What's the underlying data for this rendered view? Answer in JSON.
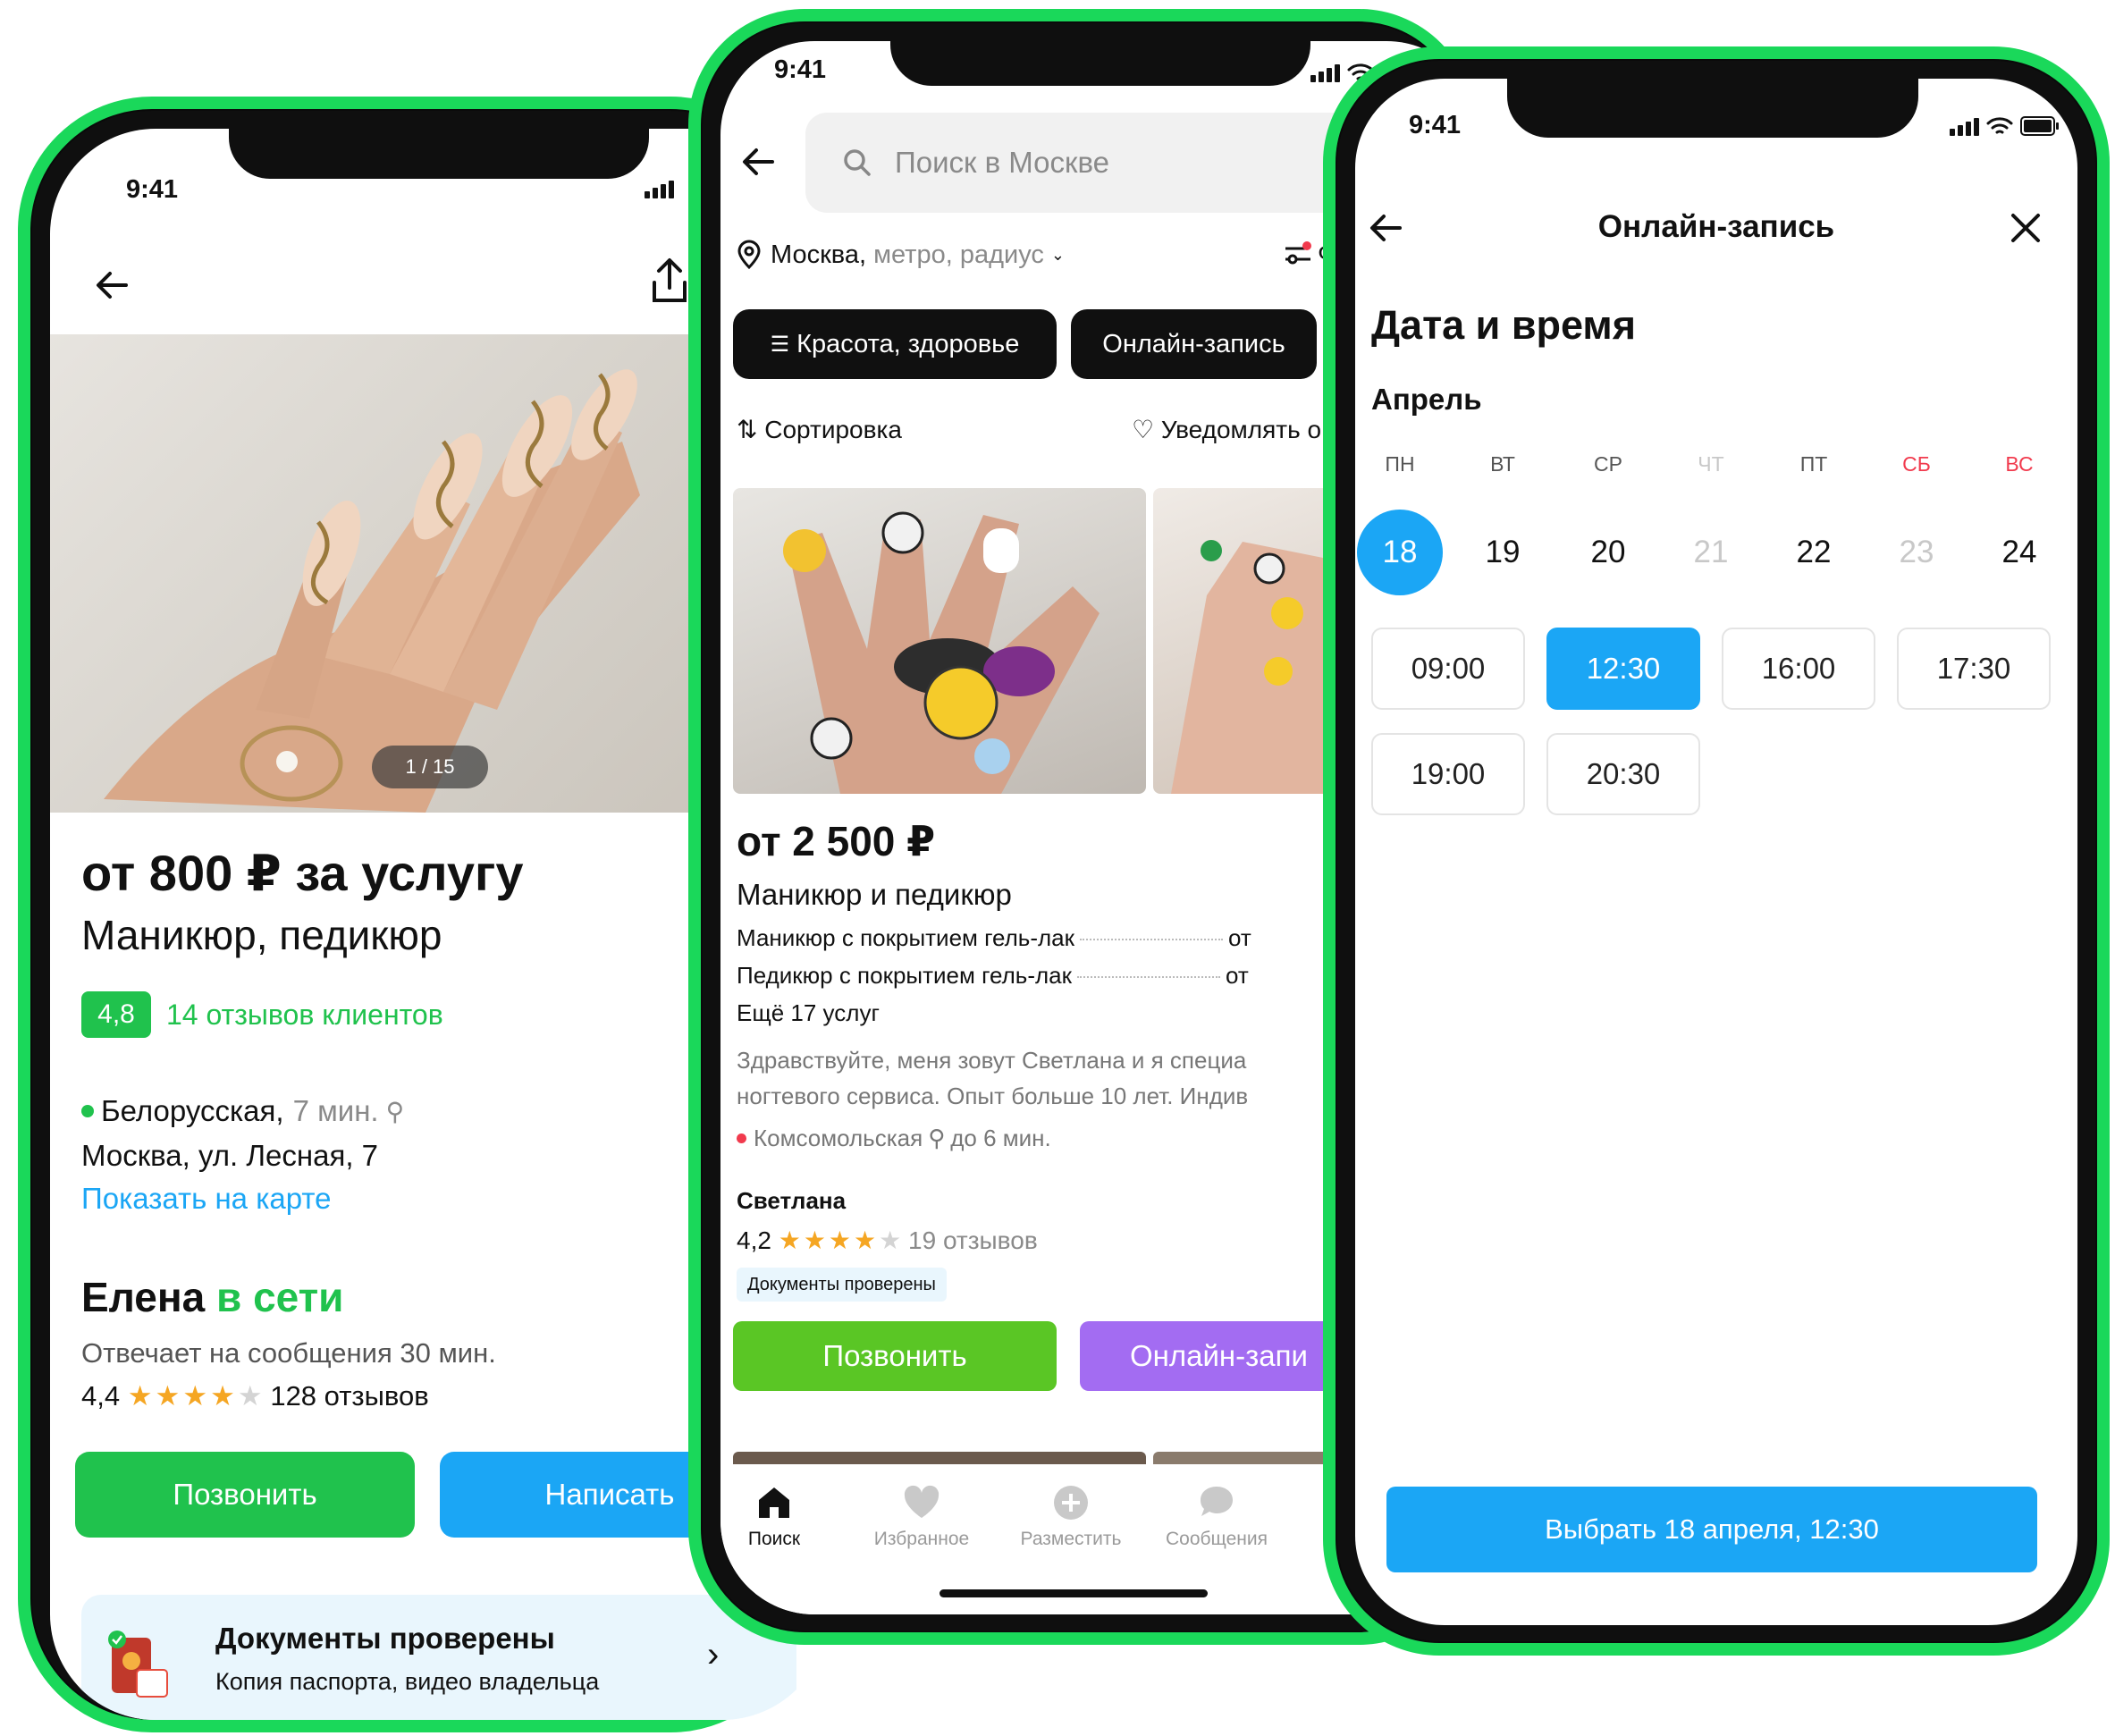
{
  "colors": {
    "brand_green": "#1ad85a",
    "green": "#20c24d",
    "blue": "#1ba6f5",
    "purple": "#a36cf2",
    "red": "#f13a4d"
  },
  "status": {
    "time": "9:41"
  },
  "phone1": {
    "photo_counter": "1 / 15",
    "price": "от 800 ₽ за услугу",
    "category": "Маникюр, педикюр",
    "rating": "4,8",
    "reviews": "14 отзывов клиентов",
    "metro": "Белорусская,",
    "metro_time": "7 мин.",
    "address": "Москва, ул. Лесная, 7",
    "map_link": "Показать на карте",
    "seller_name": "Елена",
    "seller_status": "в сети",
    "response": "Отвечает на сообщения 30 мин.",
    "seller_rating": "4,4",
    "seller_stars": "★★★★",
    "seller_star_empty": "★",
    "seller_reviews": "128 отзывов",
    "call": "Позвонить",
    "write": "Написать",
    "docs_title": "Документы проверены",
    "docs_sub": "Копия паспорта, видео владельца",
    "docs_arrow": "›"
  },
  "phone2": {
    "search_placeholder": "Поиск в Москве",
    "location": "Москва,",
    "location_extra": "метро, радиус",
    "filters": "Фи",
    "chip1": "Красота, здоровье",
    "chip2": "Онлайн-запись",
    "sort": "Сортировка",
    "notify": "Уведомлять о",
    "price": "от 2 500 ₽",
    "title": "Маникюр и педикюр",
    "service1": "Маникюр с покрытием гель-лак",
    "service1_price": "от",
    "service2": "Педикюр с покрытием гель-лак",
    "service2_price": "от",
    "more": "Ещё 17 услуг",
    "desc1": "Здравствуйте, меня зовут Светлана и я специа",
    "desc2": "ногтевого сервиса. Опыт больше 10 лет. Индив",
    "metro": "Комсомольская",
    "metro_time": "до 6 мин.",
    "seller": "Светлана",
    "rating": "4,2",
    "stars": "★★★★",
    "star_empty": "★",
    "reviews": "19 отзывов",
    "badge": "Документы проверены",
    "call": "Позвонить",
    "book": "Онлайн-запи",
    "tabs": [
      "Поиск",
      "Избранное",
      "Разместить",
      "Сообщения"
    ]
  },
  "phone3": {
    "header": "Онлайн-запись",
    "section": "Дата и время",
    "month": "Апрель",
    "weekdays": [
      "ПН",
      "ВТ",
      "СР",
      "ЧТ",
      "ПТ",
      "СБ",
      "ВС"
    ],
    "days": [
      "18",
      "19",
      "20",
      "21",
      "22",
      "23",
      "24"
    ],
    "selected_day": "18",
    "slots": [
      "09:00",
      "12:30",
      "16:00",
      "17:30",
      "19:00",
      "20:30"
    ],
    "selected_slot": "12:30",
    "confirm": "Выбрать 18 апреля, 12:30"
  }
}
